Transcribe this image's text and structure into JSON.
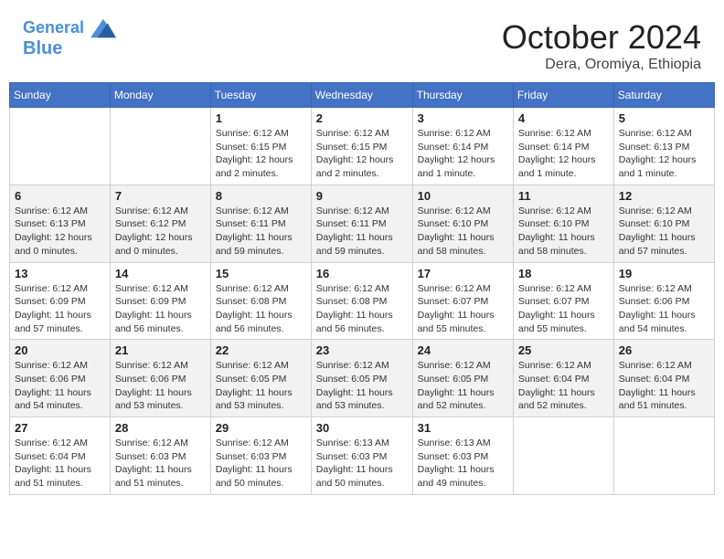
{
  "header": {
    "logo_line1": "General",
    "logo_line2": "Blue",
    "month": "October 2024",
    "location": "Dera, Oromiya, Ethiopia"
  },
  "weekdays": [
    "Sunday",
    "Monday",
    "Tuesday",
    "Wednesday",
    "Thursday",
    "Friday",
    "Saturday"
  ],
  "weeks": [
    [
      {
        "day": "",
        "info": ""
      },
      {
        "day": "",
        "info": ""
      },
      {
        "day": "1",
        "info": "Sunrise: 6:12 AM\nSunset: 6:15 PM\nDaylight: 12 hours and 2 minutes."
      },
      {
        "day": "2",
        "info": "Sunrise: 6:12 AM\nSunset: 6:15 PM\nDaylight: 12 hours and 2 minutes."
      },
      {
        "day": "3",
        "info": "Sunrise: 6:12 AM\nSunset: 6:14 PM\nDaylight: 12 hours and 1 minute."
      },
      {
        "day": "4",
        "info": "Sunrise: 6:12 AM\nSunset: 6:14 PM\nDaylight: 12 hours and 1 minute."
      },
      {
        "day": "5",
        "info": "Sunrise: 6:12 AM\nSunset: 6:13 PM\nDaylight: 12 hours and 1 minute."
      }
    ],
    [
      {
        "day": "6",
        "info": "Sunrise: 6:12 AM\nSunset: 6:13 PM\nDaylight: 12 hours and 0 minutes."
      },
      {
        "day": "7",
        "info": "Sunrise: 6:12 AM\nSunset: 6:12 PM\nDaylight: 12 hours and 0 minutes."
      },
      {
        "day": "8",
        "info": "Sunrise: 6:12 AM\nSunset: 6:11 PM\nDaylight: 11 hours and 59 minutes."
      },
      {
        "day": "9",
        "info": "Sunrise: 6:12 AM\nSunset: 6:11 PM\nDaylight: 11 hours and 59 minutes."
      },
      {
        "day": "10",
        "info": "Sunrise: 6:12 AM\nSunset: 6:10 PM\nDaylight: 11 hours and 58 minutes."
      },
      {
        "day": "11",
        "info": "Sunrise: 6:12 AM\nSunset: 6:10 PM\nDaylight: 11 hours and 58 minutes."
      },
      {
        "day": "12",
        "info": "Sunrise: 6:12 AM\nSunset: 6:10 PM\nDaylight: 11 hours and 57 minutes."
      }
    ],
    [
      {
        "day": "13",
        "info": "Sunrise: 6:12 AM\nSunset: 6:09 PM\nDaylight: 11 hours and 57 minutes."
      },
      {
        "day": "14",
        "info": "Sunrise: 6:12 AM\nSunset: 6:09 PM\nDaylight: 11 hours and 56 minutes."
      },
      {
        "day": "15",
        "info": "Sunrise: 6:12 AM\nSunset: 6:08 PM\nDaylight: 11 hours and 56 minutes."
      },
      {
        "day": "16",
        "info": "Sunrise: 6:12 AM\nSunset: 6:08 PM\nDaylight: 11 hours and 56 minutes."
      },
      {
        "day": "17",
        "info": "Sunrise: 6:12 AM\nSunset: 6:07 PM\nDaylight: 11 hours and 55 minutes."
      },
      {
        "day": "18",
        "info": "Sunrise: 6:12 AM\nSunset: 6:07 PM\nDaylight: 11 hours and 55 minutes."
      },
      {
        "day": "19",
        "info": "Sunrise: 6:12 AM\nSunset: 6:06 PM\nDaylight: 11 hours and 54 minutes."
      }
    ],
    [
      {
        "day": "20",
        "info": "Sunrise: 6:12 AM\nSunset: 6:06 PM\nDaylight: 11 hours and 54 minutes."
      },
      {
        "day": "21",
        "info": "Sunrise: 6:12 AM\nSunset: 6:06 PM\nDaylight: 11 hours and 53 minutes."
      },
      {
        "day": "22",
        "info": "Sunrise: 6:12 AM\nSunset: 6:05 PM\nDaylight: 11 hours and 53 minutes."
      },
      {
        "day": "23",
        "info": "Sunrise: 6:12 AM\nSunset: 6:05 PM\nDaylight: 11 hours and 53 minutes."
      },
      {
        "day": "24",
        "info": "Sunrise: 6:12 AM\nSunset: 6:05 PM\nDaylight: 11 hours and 52 minutes."
      },
      {
        "day": "25",
        "info": "Sunrise: 6:12 AM\nSunset: 6:04 PM\nDaylight: 11 hours and 52 minutes."
      },
      {
        "day": "26",
        "info": "Sunrise: 6:12 AM\nSunset: 6:04 PM\nDaylight: 11 hours and 51 minutes."
      }
    ],
    [
      {
        "day": "27",
        "info": "Sunrise: 6:12 AM\nSunset: 6:04 PM\nDaylight: 11 hours and 51 minutes."
      },
      {
        "day": "28",
        "info": "Sunrise: 6:12 AM\nSunset: 6:03 PM\nDaylight: 11 hours and 51 minutes."
      },
      {
        "day": "29",
        "info": "Sunrise: 6:12 AM\nSunset: 6:03 PM\nDaylight: 11 hours and 50 minutes."
      },
      {
        "day": "30",
        "info": "Sunrise: 6:13 AM\nSunset: 6:03 PM\nDaylight: 11 hours and 50 minutes."
      },
      {
        "day": "31",
        "info": "Sunrise: 6:13 AM\nSunset: 6:03 PM\nDaylight: 11 hours and 49 minutes."
      },
      {
        "day": "",
        "info": ""
      },
      {
        "day": "",
        "info": ""
      }
    ]
  ]
}
